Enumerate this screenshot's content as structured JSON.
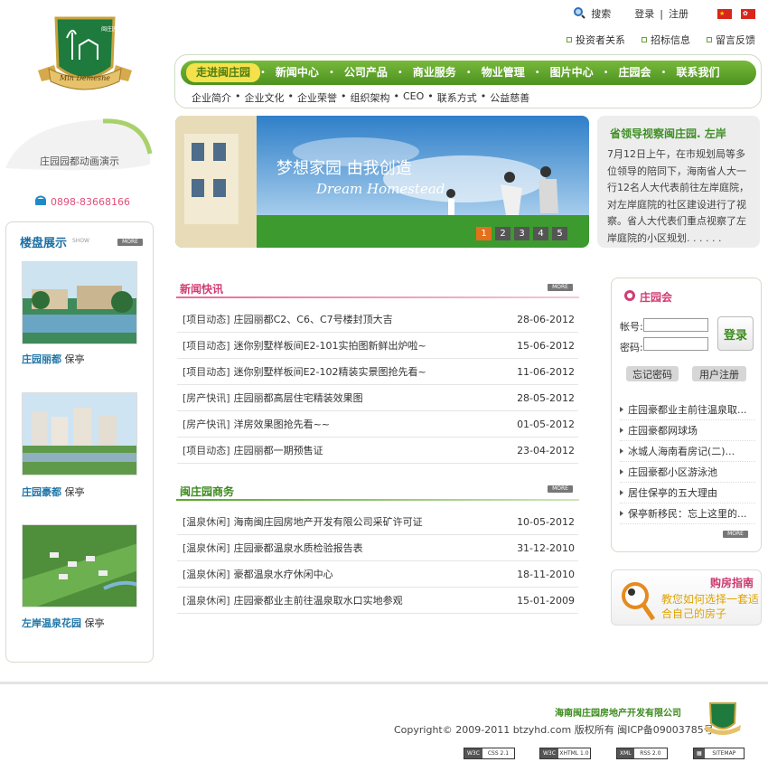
{
  "logo_text": "Min Demesne",
  "logo_subtext": "闽庄园",
  "top": {
    "search": "搜索",
    "login": "登录",
    "sep": "|",
    "register": "注册"
  },
  "sublinks": [
    "投资者关系",
    "招标信息",
    "留言反馈"
  ],
  "nav": {
    "items": [
      "走进闽庄园",
      "新闻中心",
      "公司产品",
      "商业服务",
      "物业管理",
      "图片中心",
      "庄园会",
      "联系我们"
    ],
    "sub": [
      "企业简介",
      "企业文化",
      "企业荣誉",
      "组织架构",
      "CEO",
      "联系方式",
      "公益慈善"
    ]
  },
  "anim_label": "庄园园都动画演示",
  "phone": "0898-83668166",
  "showcase": {
    "title": "楼盘展示",
    "sub": "SHOW",
    "more": "MORE",
    "items": [
      {
        "name": "庄园丽都",
        "tag": "保亭"
      },
      {
        "name": "庄园豪都",
        "tag": "保亭"
      },
      {
        "name": "左岸温泉花园",
        "tag": "保亭"
      }
    ]
  },
  "banner": {
    "cn": "梦想家园 由我创造",
    "en": "Dream Homestead",
    "dots": [
      "1",
      "2",
      "3",
      "4",
      "5"
    ]
  },
  "headline": {
    "title": "省领导视察闽庄园. 左岸",
    "body": "7月12日上午，在市规划局等多位领导的陪同下，海南省人大一行12名人大代表前往左岸庭院，对左岸庭院的社区建设进行了视察。省人大代表们重点视察了左岸庭院的小区规划. . . . . ."
  },
  "news": {
    "title": "新闻快讯",
    "more": "MORE",
    "rows": [
      {
        "cat": "[项目动态]",
        "title": "庄园丽都C2、C6、C7号楼封顶大吉",
        "date": "28-06-2012"
      },
      {
        "cat": "[项目动态]",
        "title": "迷你别墅样板间E2-101实拍图新鲜出炉啦~",
        "date": "15-06-2012"
      },
      {
        "cat": "[项目动态]",
        "title": "迷你别墅样板间E2-102精装实景图抢先看~",
        "date": "11-06-2012"
      },
      {
        "cat": "[房产快讯]",
        "title": "庄园丽都高层住宅精装效果图",
        "date": "28-05-2012"
      },
      {
        "cat": "[房产快讯]",
        "title": "洋房效果图抢先看~~",
        "date": "01-05-2012"
      },
      {
        "cat": "[项目动态]",
        "title": "庄园丽都一期预售证",
        "date": "23-04-2012"
      }
    ]
  },
  "business": {
    "title": "闽庄园商务",
    "more": "MORE",
    "rows": [
      {
        "cat": "[温泉休闲]",
        "title": "海南闽庄园房地产开发有限公司采矿许可证",
        "date": "10-05-2012"
      },
      {
        "cat": "[温泉休闲]",
        "title": "庄园豪都温泉水质检验报告表",
        "date": "31-12-2010"
      },
      {
        "cat": "[温泉休闲]",
        "title": "豪都温泉水疗休闲中心",
        "date": "18-11-2010"
      },
      {
        "cat": "[温泉休闲]",
        "title": "庄园豪都业主前往温泉取水口实地参观",
        "date": "15-01-2009"
      }
    ]
  },
  "club": {
    "title": "庄园会",
    "account": "帐号:",
    "password": "密码:",
    "login": "登录",
    "forgot": "忘记密码",
    "register": "用户注册",
    "more": "MORE",
    "items": [
      "庄园豪都业主前往温泉取...",
      "庄园豪都网球场",
      "冰城人海南看房记(二)...",
      "庄园豪都小区游泳池",
      "居住保亭的五大理由",
      "保亭新移民：忘上这里的..."
    ]
  },
  "guide": {
    "title": "购房指南",
    "text": "教您如何选择一套适合自己的房子"
  },
  "footer": {
    "company": "海南闽庄园房地产开发有限公司",
    "copyright": "Copyright© 2009-2011 btzyhd.com 版权所有 闽ICP备09003785号",
    "badges": [
      {
        "a": "W3C",
        "b": "CSS 2.1"
      },
      {
        "a": "W3C",
        "b": "XHTML 1.0"
      },
      {
        "a": "XML",
        "b": "RSS 2.0"
      },
      {
        "a": "▦",
        "b": "SITEMAP"
      }
    ]
  },
  "colors": {
    "brand_green": "#4d9220",
    "accent_pink": "#e04f79",
    "link_blue": "#2277a8"
  }
}
